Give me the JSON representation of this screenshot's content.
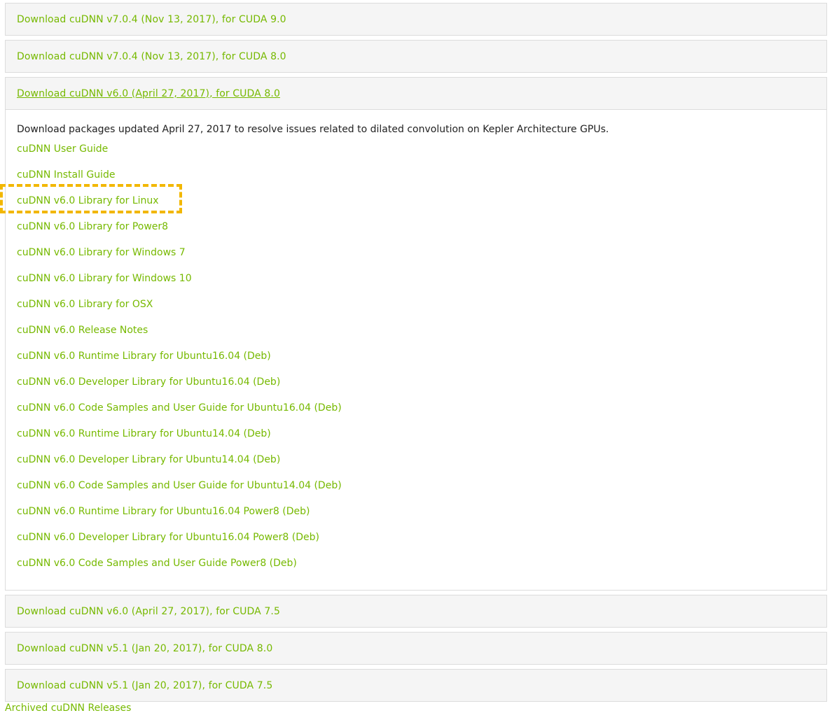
{
  "panels_top": [
    {
      "label": "Download cuDNN v7.0.4 (Nov 13, 2017), for CUDA 9.0"
    },
    {
      "label": "Download cuDNN v7.0.4 (Nov 13, 2017), for CUDA 8.0"
    }
  ],
  "open_panel": {
    "label": "Download cuDNN v6.0 (April 27, 2017), for CUDA 8.0",
    "description": "Download packages updated April 27, 2017 to resolve issues related to dilated convolution on Kepler Architecture GPUs.",
    "links": [
      "cuDNN User Guide",
      "cuDNN Install Guide",
      "cuDNN v6.0 Library for Linux",
      "cuDNN v6.0 Library for Power8",
      "cuDNN v6.0 Library for Windows 7",
      "cuDNN v6.0 Library for Windows 10",
      "cuDNN v6.0 Library for OSX",
      "cuDNN v6.0 Release Notes",
      "cuDNN v6.0 Runtime Library for Ubuntu16.04 (Deb)",
      "cuDNN v6.0 Developer Library for Ubuntu16.04 (Deb)",
      "cuDNN v6.0 Code Samples and User Guide for Ubuntu16.04 (Deb)",
      "cuDNN v6.0 Runtime Library for Ubuntu14.04 (Deb)",
      "cuDNN v6.0 Developer Library for Ubuntu14.04 (Deb)",
      "cuDNN v6.0 Code Samples and User Guide for Ubuntu14.04 (Deb)",
      "cuDNN v6.0 Runtime Library for Ubuntu16.04 Power8 (Deb)",
      "cuDNN v6.0 Developer Library for Ubuntu16.04 Power8 (Deb)",
      "cuDNN v6.0 Code Samples and User Guide Power8 (Deb)"
    ],
    "highlighted_link_index": 2
  },
  "panels_bottom": [
    {
      "label": "Download cuDNN v6.0 (April 27, 2017), for CUDA 7.5"
    },
    {
      "label": "Download cuDNN v5.1 (Jan 20, 2017), for CUDA 8.0"
    },
    {
      "label": "Download cuDNN v5.1 (Jan 20, 2017), for CUDA 7.5"
    }
  ],
  "archived_link": "Archived cuDNN Releases",
  "colors": {
    "link": "#76b900",
    "highlight": "#f2b700",
    "panel_bg": "#f5f5f5",
    "border": "#dcdcdc"
  }
}
